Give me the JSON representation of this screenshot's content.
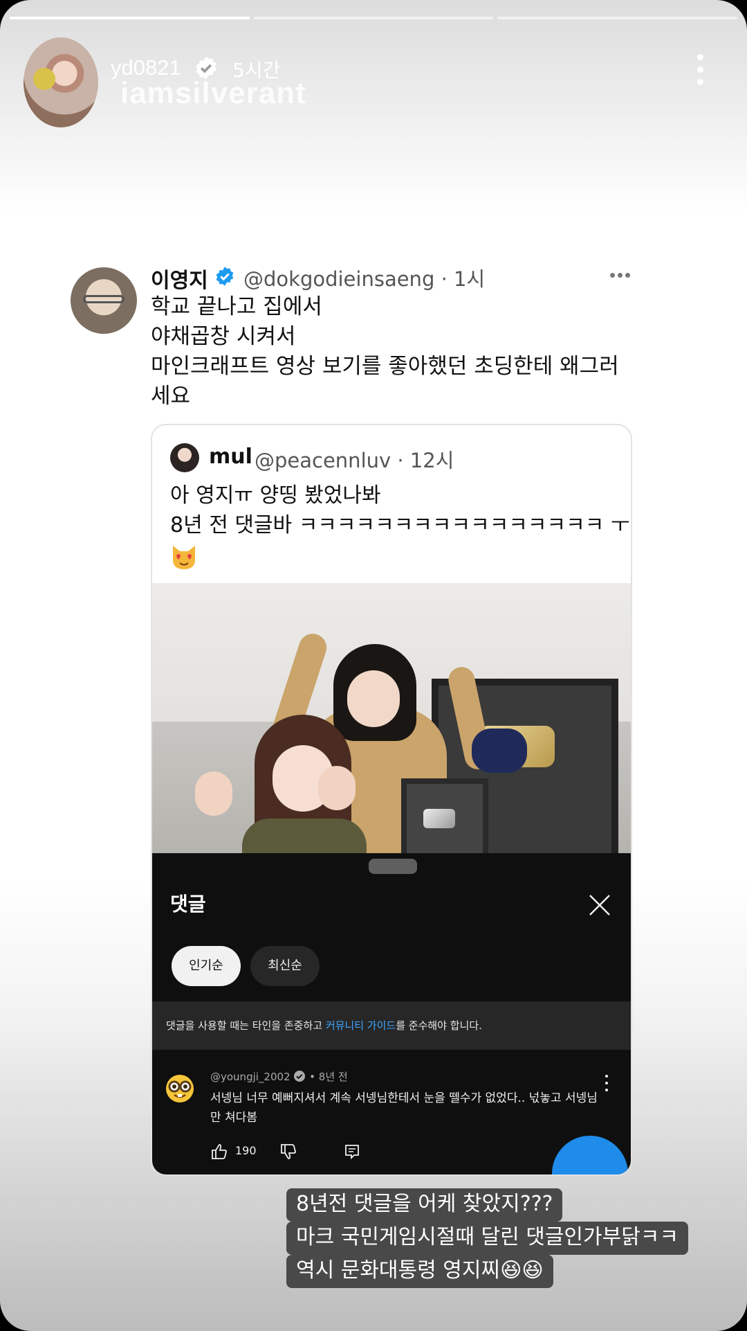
{
  "story": {
    "progress": [
      1,
      0,
      0
    ],
    "username": "yd0821",
    "time": "5시간",
    "subtitle": "iamsilverant"
  },
  "tweet": {
    "name": "이영지",
    "handle": "@dokgodieinsaeng · 1시",
    "lines": [
      "학교 끝나고 집에서",
      "야채곱창 시켜서",
      "마인크래프트 영상 보기를 좋아했던 초딩한테 왜그러",
      "세요"
    ]
  },
  "quote": {
    "name": "mul",
    "handle": "@peacennluv · 12시",
    "lines": [
      "아 영지ㅠ 양띵 봤었나봐",
      "8년 전 댓글바 ㅋㅋㅋㅋㅋㅋㅋㅋㅋㅋㅋㅋㅋㅋㅋㅋ ㅜ"
    ],
    "emoji_icon": "heart-eyes-cat-icon"
  },
  "youtube": {
    "panel_title": "댓글",
    "chip_popular": "인기순",
    "chip_newest": "최신순",
    "notice_before": "댓글을 사용할 때는 타인을 존중하고 ",
    "notice_link": "커뮤니티 가이드",
    "notice_after": "를 준수해야 합니다.",
    "comment_author": "@youngji_2002",
    "comment_age": "• 8년 전",
    "comment_text": "서넹님 너무 예뻐지셔서 계속 서넹님한테서 눈을 뗄수가 없었다.. 넋놓고 서넹님만 쳐다봄",
    "likes": "190",
    "avatar_icon": "nerd-face-icon",
    "accent": "#3ea6ff"
  },
  "captions": {
    "line1": "8년전 댓글을 어케 찾았지???",
    "line2": "마크 국민게임시절때 달린 댓글인가부닭ㅋㅋ",
    "line3": "역시 문화대통령 영지찌😆😆"
  },
  "colors": {
    "verified_blue": "#1d9bf0",
    "caption_bg": "#494949"
  }
}
